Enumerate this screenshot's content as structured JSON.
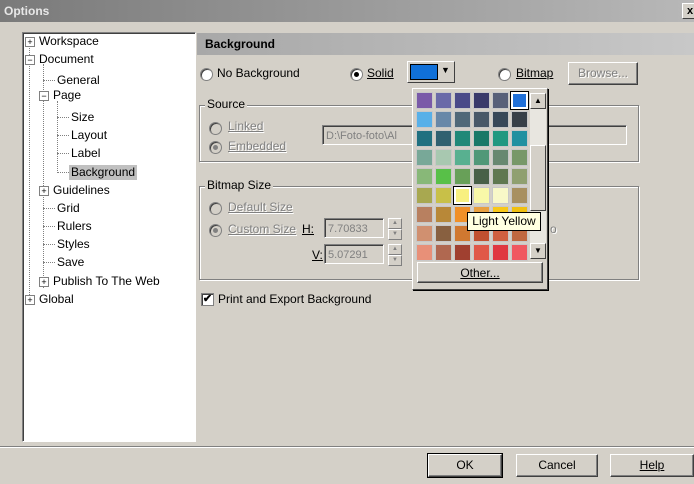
{
  "window": {
    "title": "Options",
    "close_glyph": "x"
  },
  "tree": {
    "items": [
      {
        "label": "Workspace"
      },
      {
        "label": "Document"
      },
      {
        "label": "General"
      },
      {
        "label": "Page"
      },
      {
        "label": "Size"
      },
      {
        "label": "Layout"
      },
      {
        "label": "Label"
      },
      {
        "label": "Background",
        "selected": true
      },
      {
        "label": "Guidelines"
      },
      {
        "label": "Grid"
      },
      {
        "label": "Rulers"
      },
      {
        "label": "Styles"
      },
      {
        "label": "Save"
      },
      {
        "label": "Publish To The Web"
      },
      {
        "label": "Global"
      }
    ]
  },
  "panel": {
    "header": "Background",
    "no_background": {
      "label": "No Background",
      "checked": false
    },
    "solid": {
      "label": "Solid",
      "checked": true
    },
    "bitmap": {
      "label": "Bitmap",
      "checked": false
    },
    "browse_label": "Browse...",
    "solid_color": "#1070d8"
  },
  "source": {
    "title": "Source",
    "linked_label": "Linked",
    "embedded_label": "Embedded",
    "path_value": "D:\\Foto-foto\\Al"
  },
  "bitmap_size": {
    "title": "Bitmap Size",
    "default_label": "Default Size",
    "custom_label": "Custom Size",
    "h_label": "H:",
    "h_value": "7.70833",
    "v_label": "V:",
    "v_value": "5.07291",
    "trailing_text": "o"
  },
  "print_export": {
    "label": "Print and Export Background",
    "checked": true
  },
  "palette": {
    "tooltip": "Light Yellow",
    "other_label": "Other...",
    "colors": [
      [
        "#7a5aa8",
        "#6a6aa8",
        "#4a4a88",
        "#3a3a6a",
        "#586078",
        "#2070d8"
      ],
      [
        "#58b0e8",
        "#6888a8",
        "#506878",
        "#485868",
        "#384858",
        "#384048"
      ],
      [
        "#207080",
        "#306070",
        "#208878",
        "#187868",
        "#209880",
        "#2090a0"
      ],
      [
        "#78a898",
        "#a8c8b0",
        "#58b090",
        "#509878",
        "#688870",
        "#789868"
      ],
      [
        "#88b878",
        "#58c048",
        "#68a058",
        "#486048",
        "#607850",
        "#90a070"
      ],
      [
        "#a8a850",
        "#c8c048",
        "#f8f080",
        "#f8f8a8",
        "#f8f8c8",
        "#a89060"
      ],
      [
        "#b88060",
        "#b88838",
        "#f09028",
        "#e8a040",
        "#f8c818",
        "#f0c010"
      ],
      [
        "#d09070",
        "#886040",
        "#d07830",
        "#c05030",
        "#d06040",
        "#c06840"
      ],
      [
        "#e89078",
        "#b06850",
        "#a04030",
        "#e05848",
        "#e03840",
        "#f05860"
      ]
    ]
  },
  "footer": {
    "ok_label": "OK",
    "cancel_label": "Cancel",
    "help_label": "Help"
  }
}
